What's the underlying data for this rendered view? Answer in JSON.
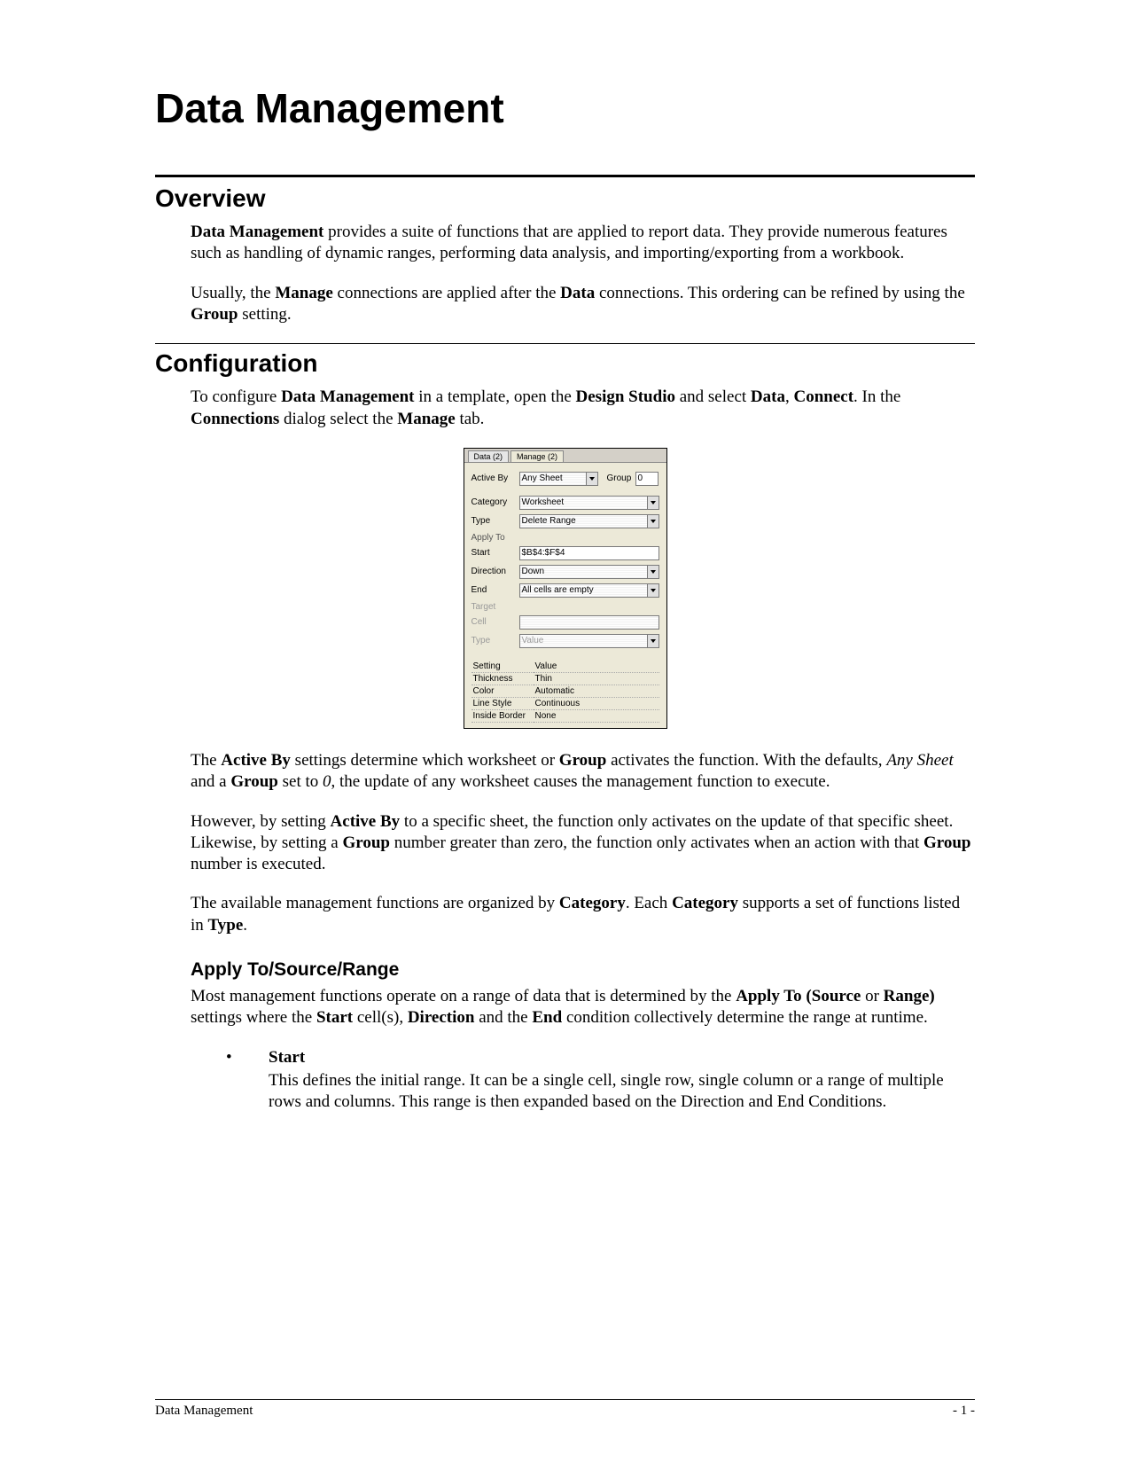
{
  "title": "Data Management",
  "sections": {
    "overview": {
      "heading": "Overview",
      "p1_lead_bold": "Data Management",
      "p1_rest": " provides a suite of functions that are applied to report data.  They provide numerous features such as handling of dynamic ranges, performing data analysis, and importing/exporting from a workbook.",
      "p2_a": "Usually, the ",
      "p2_b": "Manage",
      "p2_c": " connections are applied after the ",
      "p2_d": "Data",
      "p2_e": " connections.  This ordering can be refined by using the ",
      "p2_f": "Group",
      "p2_g": " setting."
    },
    "configuration": {
      "heading": "Configuration",
      "p1_a": "To configure ",
      "p1_b": "Data Management",
      "p1_c": " in a template, open the ",
      "p1_d": "Design Studio",
      "p1_e": " and select ",
      "p1_f": "Data",
      "p1_g": ", ",
      "p1_h": "Connect",
      "p1_i": ".  In the ",
      "p1_j": "Connections",
      "p1_k": " dialog select the ",
      "p1_l": "Manage",
      "p1_m": " tab.",
      "p2_a": "The ",
      "p2_b": "Active By",
      "p2_c": " settings determine which worksheet or ",
      "p2_d": "Group",
      "p2_e": " activates the function.  With the defaults, ",
      "p2_f": "Any Sheet",
      "p2_g": " and a ",
      "p2_h": "Group",
      "p2_i": " set to ",
      "p2_j": "0",
      "p2_k": ", the update of any worksheet causes the management function to execute.",
      "p3_a": "However, by setting ",
      "p3_b": "Active By",
      "p3_c": " to a specific sheet, the function only activates on the update of that specific sheet.  Likewise, by setting a ",
      "p3_d": "Group",
      "p3_e": " number greater than zero, the function only activates when an action with that ",
      "p3_f": "Group",
      "p3_g": " number is executed.",
      "p4_a": "The available management functions are organized by ",
      "p4_b": "Category",
      "p4_c": ".  Each ",
      "p4_d": "Category",
      "p4_e": " supports a set of functions listed in ",
      "p4_f": "Type",
      "p4_g": "."
    },
    "applyto": {
      "heading": "Apply To/Source/Range",
      "p1_a": "Most management functions operate on a range of data that is determined by the ",
      "p1_b": "Apply To (Source",
      "p1_c": " or ",
      "p1_d": "Range)",
      "p1_e": " settings where the ",
      "p1_f": "Start",
      "p1_g": " cell(s), ",
      "p1_h": "Direction",
      "p1_i": " and the ",
      "p1_j": "End",
      "p1_k": " condition collectively determine the range at runtime.",
      "bullet": {
        "title": "Start",
        "text": "This defines the initial range.  It can be a single cell, single row, single column or a range of multiple rows and columns.  This range is then expanded based on the Direction and End Conditions."
      }
    }
  },
  "dialog": {
    "tabs": {
      "data": "Data (2)",
      "manage": "Manage (2)"
    },
    "labels": {
      "activeBy": "Active By",
      "group": "Group",
      "category": "Category",
      "type": "Type",
      "applyTo": "Apply To",
      "start": "Start",
      "direction": "Direction",
      "end": "End",
      "target": "Target",
      "cell": "Cell",
      "type2": "Type"
    },
    "values": {
      "activeBy": "Any Sheet",
      "group": "0",
      "category": "Worksheet",
      "type": "Delete Range",
      "start": "$B$4:$F$4",
      "direction": "Down",
      "end": "All cells are empty",
      "cell": "",
      "type2": "Value"
    },
    "grid": {
      "h1": "Setting",
      "h2": "Value",
      "r1a": "Thickness",
      "r1b": "Thin",
      "r2a": "Color",
      "r2b": "Automatic",
      "r3a": "Line Style",
      "r3b": "Continuous",
      "r4a": "Inside Border",
      "r4b": "None"
    }
  },
  "footer": {
    "left": "Data Management",
    "right": "- 1 -"
  }
}
